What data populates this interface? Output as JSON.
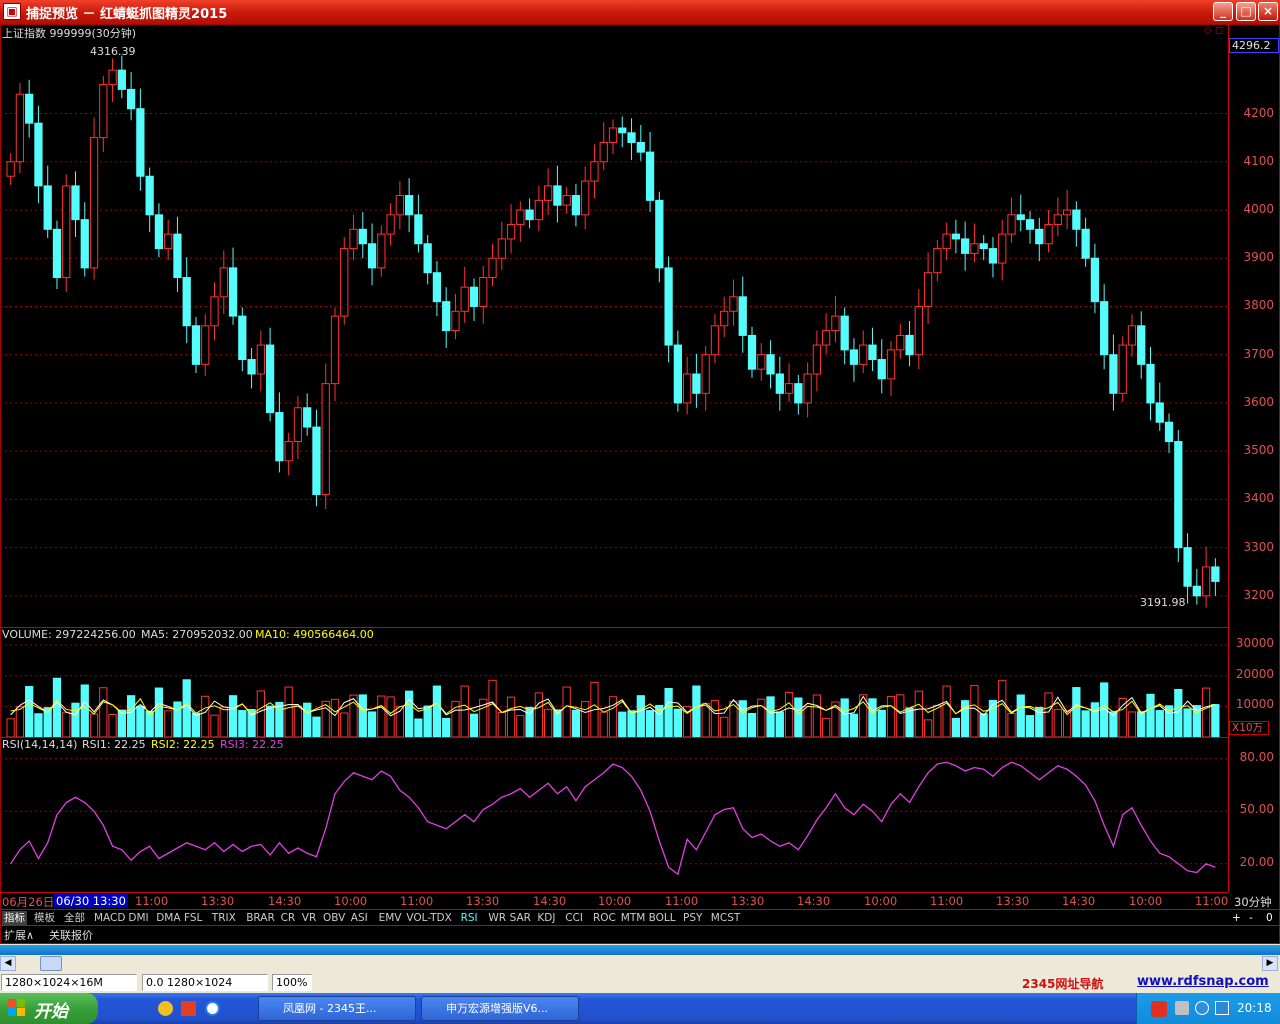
{
  "window": {
    "title": "捕捉预览 － 红蜻蜓抓图精灵2015",
    "app_icon": "camera-icon",
    "minimize_label": "_",
    "maximize_label": "□",
    "close_label": "×"
  },
  "chart_header": {
    "symbol_label": "上证指数 999999(30分钟)",
    "high_marker": "4316.39",
    "low_marker": "3191.98",
    "current_price": "4296.2"
  },
  "volume_header": {
    "label": "VOLUME: 297224256.00",
    "ma5": "MA5: 270952032.00",
    "ma10": "MA10: 490566464.00",
    "unit": "X10万"
  },
  "rsi_header": {
    "label": "RSI(14,14,14)",
    "rsi1": "RSI1: 22.25",
    "rsi2": "RSI2: 22.25",
    "rsi3": "RSI3: 22.25"
  },
  "colors": {
    "up": "#ff3232",
    "down": "#54fcfc",
    "grid": "#a00000",
    "axis_text": "#e05050",
    "rsi_line": "#e040e0",
    "ma5": "#ffffff",
    "ma10": "#ffff00"
  },
  "price_axis_labels": [
    "4200",
    "4100",
    "4000",
    "3900",
    "3800",
    "3700",
    "3600",
    "3500",
    "3400",
    "3300",
    "3200"
  ],
  "volume_axis_labels": [
    "30000",
    "20000",
    "10000"
  ],
  "rsi_axis_labels": [
    "80.00",
    "50.00",
    "20.00"
  ],
  "time_axis": {
    "labels": [
      "06月26日",
      "06/30 13:30",
      "11:00",
      "13:30",
      "14:30",
      "10:00",
      "11:00",
      "13:30",
      "14:30",
      "10:00",
      "11:00",
      "13:30",
      "14:30",
      "10:00",
      "11:00",
      "13:30",
      "14:30",
      "10:00",
      "11:00"
    ],
    "period": "30分钟"
  },
  "indicator_tabs": [
    "指标",
    "模板",
    "全部",
    "MACD",
    "DMI",
    "DMA",
    "FSL",
    "TRIX",
    "BRAR",
    "CR",
    "VR",
    "OBV",
    "ASI",
    "EMV",
    "VOL-TDX",
    "RSI",
    "WR",
    "SAR",
    "KDJ",
    "CCI",
    "ROC",
    "MTM",
    "BOLL",
    "PSY",
    "MCST"
  ],
  "active_tab": "RSI",
  "zoom_controls": [
    "+",
    "-",
    "0"
  ],
  "sub_tabs": [
    "扩展∧",
    "关联报价"
  ],
  "status": {
    "image_info": "1280×1024×16M",
    "coords": "0.0 1280×1024",
    "zoom": "100%",
    "link1": "2345网址导航",
    "link2": "www.rdfsnap.com"
  },
  "taskbar": {
    "start_label": "开始",
    "tasks": [
      "凤凰网 - 2345王...",
      "申万宏源增强版V6..."
    ],
    "clock": "20:18"
  },
  "chart_data": {
    "type": "candlestick",
    "price_ylim": [
      3150,
      4340
    ],
    "volume_ylim": [
      0,
      33000
    ],
    "rsi_ylim": [
      5,
      85
    ],
    "closes": [
      4100,
      4240,
      4180,
      4050,
      3960,
      3860,
      4050,
      3980,
      3880,
      4150,
      4260,
      4290,
      4250,
      4210,
      4070,
      3990,
      3920,
      3950,
      3860,
      3760,
      3680,
      3760,
      3820,
      3880,
      3780,
      3690,
      3660,
      3720,
      3580,
      3480,
      3520,
      3590,
      3550,
      3410,
      3640,
      3780,
      3920,
      3960,
      3930,
      3880,
      3950,
      3990,
      4030,
      3990,
      3930,
      3870,
      3810,
      3750,
      3790,
      3840,
      3800,
      3860,
      3900,
      3940,
      3970,
      4000,
      3980,
      4020,
      4050,
      4010,
      4030,
      3990,
      4060,
      4100,
      4140,
      4170,
      4160,
      4140,
      4120,
      4020,
      3880,
      3720,
      3600,
      3660,
      3620,
      3700,
      3760,
      3790,
      3820,
      3740,
      3670,
      3700,
      3660,
      3620,
      3640,
      3600,
      3660,
      3720,
      3750,
      3780,
      3710,
      3680,
      3720,
      3690,
      3650,
      3710,
      3740,
      3700,
      3800,
      3870,
      3920,
      3950,
      3940,
      3910,
      3930,
      3920,
      3890,
      3950,
      3990,
      3980,
      3960,
      3930,
      3970,
      3990,
      4000,
      3960,
      3900,
      3810,
      3700,
      3620,
      3720,
      3760,
      3680,
      3600,
      3560,
      3520,
      3300,
      3220,
      3200,
      3260,
      3230
    ],
    "volume_ma10": [
      8500,
      9000,
      11000,
      9500,
      8000,
      12000,
      9000,
      8500,
      10000,
      7500,
      11500,
      10500,
      8000,
      9000,
      12500,
      7000,
      10000,
      9500,
      8800,
      11000,
      7800,
      9500,
      10200,
      8900,
      9000,
      10800,
      7500,
      9400,
      11200,
      8700,
      9600,
      10100,
      7900,
      9300,
      10600,
      8200,
      9800,
      11400,
      8600,
      9100,
      10300,
      7700,
      9900,
      10700,
      8400,
      9200,
      11100,
      7600,
      9700,
      10400,
      8300,
      9500,
      10900,
      8000,
      9300,
      10000,
      8800,
      9600,
      11300,
      7400,
      10200,
      9700,
      8900,
      10500,
      8100,
      9400,
      11600,
      7800,
      9000,
      10800,
      8600,
      9900,
      10100,
      7700,
      9800,
      11000,
      8500,
      9200,
      10600,
      7900,
      9600,
      10300,
      8200,
      9100,
      11200,
      7500,
      10000,
      9800,
      8700,
      10400,
      8300,
      9300,
      11500,
      7800,
      9700,
      10200,
      8100,
      9500,
      10700,
      8000,
      9400,
      11100,
      7600,
      9900,
      10500,
      8400,
      9200,
      10900,
      7700,
      9800,
      10000,
      8800,
      9600,
      11300,
      7300,
      10100,
      9500,
      8600,
      10400,
      8200,
      9000,
      11700,
      7500,
      9300,
      10800,
      8500,
      9700,
      10200,
      7900,
      9400,
      10600
    ],
    "rsi": [
      20,
      28,
      33,
      23,
      32,
      48,
      55,
      58,
      55,
      50,
      42,
      30,
      28,
      22,
      27,
      30,
      23,
      26,
      29,
      32,
      30,
      28,
      32,
      27,
      31,
      27,
      30,
      31,
      25,
      32,
      26,
      29,
      26,
      24,
      40,
      60,
      67,
      72,
      70,
      68,
      73,
      70,
      62,
      58,
      52,
      44,
      42,
      40,
      44,
      48,
      44,
      51,
      54,
      58,
      60,
      63,
      58,
      62,
      66,
      60,
      64,
      56,
      64,
      68,
      72,
      77,
      75,
      70,
      62,
      50,
      33,
      18,
      14,
      34,
      28,
      38,
      48,
      51,
      52,
      40,
      35,
      37,
      33,
      30,
      32,
      28,
      36,
      45,
      52,
      60,
      52,
      48,
      54,
      50,
      44,
      54,
      60,
      55,
      64,
      72,
      77,
      78,
      76,
      73,
      75,
      74,
      70,
      75,
      78,
      76,
      72,
      68,
      72,
      76,
      74,
      70,
      65,
      56,
      42,
      30,
      48,
      52,
      42,
      33,
      26,
      24,
      20,
      16,
      15,
      20,
      18
    ]
  }
}
